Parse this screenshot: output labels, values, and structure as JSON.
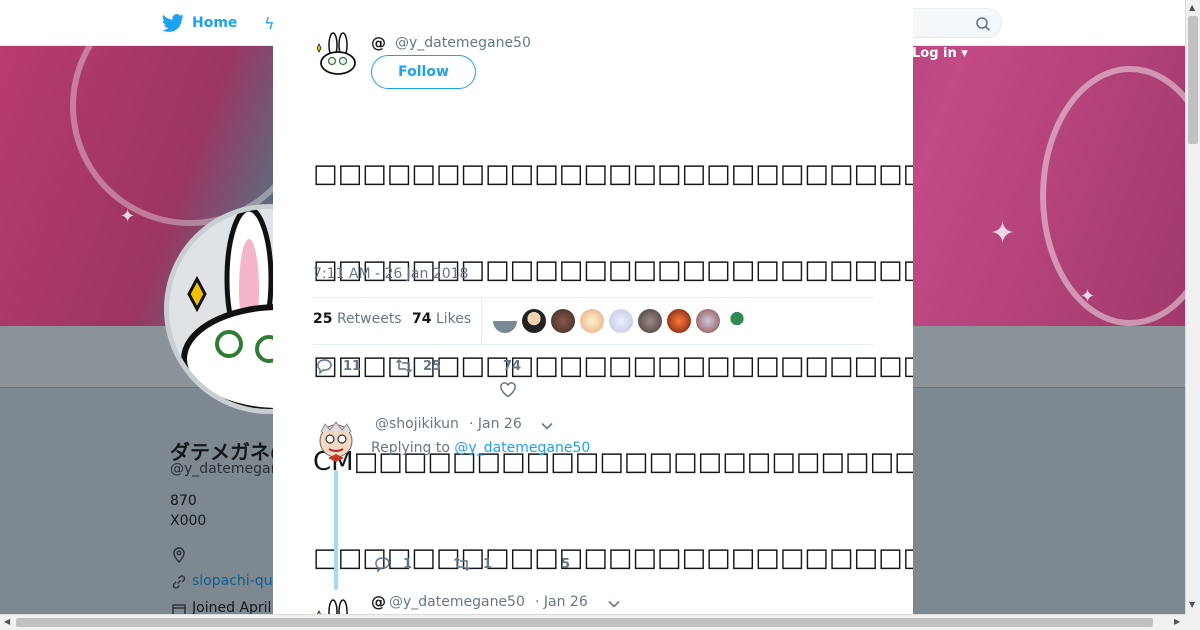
{
  "nav": {
    "home_label": "Home",
    "login_label": "Log in"
  },
  "profile": {
    "name": "ダテメガネ@いつも…",
    "handle": "@y_datemegane",
    "stat1": "870",
    "stat2": "X000",
    "link": "slopachi-qu",
    "joined": "Joined April"
  },
  "tweet": {
    "at_symbol": "@",
    "handle": "@y_datemegane50",
    "follow_label": "Follow",
    "text_lines": [
      "□□□□□□□□□□□□□□□□□□□□□□□□□□□□□□…□",
      "□□□□□□□□□□□□□□□□□□□□□□□□□□□□",
      "□□□□□□□□□□□□□□□□□□□□□□□□□□□□□□□□□□□□",
      "CM□□□□□□□□□□□□□□□□□□□□□□□□",
      "□□□□□□□□□□□□□□□□□□□□□□□□□□□□□□□□□□□□□□□□□□□□□□□"
    ],
    "timestamp": "7:11 AM - 26 Jan 2018",
    "retweets_count": "25",
    "retweets_label": "Retweets",
    "likes_count": "74",
    "likes_label": "Likes",
    "actions": {
      "replies": "11",
      "retweets": "25",
      "likes": "74"
    }
  },
  "replies": [
    {
      "handle": "@shojikikun",
      "date": "· Jan 26",
      "replying_prefix": "Replying to",
      "replying_to": "@y_datemegane50",
      "actions": {
        "replies": "1",
        "retweets": "1",
        "likes": "5"
      }
    },
    {
      "at_symbol": "@",
      "handle": "@y_datemegane50",
      "date": "· Jan 26"
    }
  ],
  "colors": {
    "accent": "#1da1f2",
    "secondary_text": "#657786",
    "thread_line": "#a6d8fa"
  }
}
